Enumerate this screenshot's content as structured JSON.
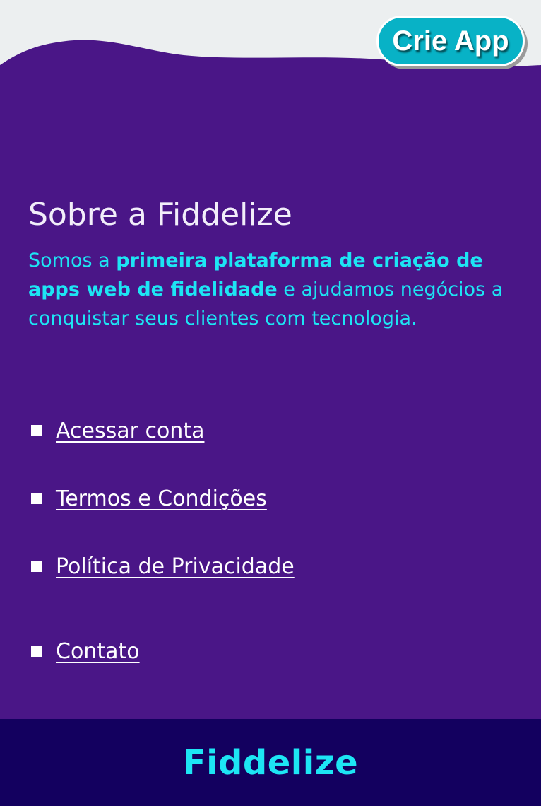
{
  "header": {
    "cta_label": "Crie App"
  },
  "about": {
    "title": "Sobre a Fiddelize",
    "text_start": "Somos a ",
    "text_bold": "primeira plataforma de criação de apps web de fidelidade",
    "text_end": " e ajudamos negócios a conquistar seus clientes com tecnologia."
  },
  "links": [
    {
      "label": "Acessar conta"
    },
    {
      "label": "Termos e Condições"
    },
    {
      "label": "Política de Privacidade"
    },
    {
      "label": "Contato"
    }
  ],
  "footer": {
    "brand": "Fiddelize"
  },
  "colors": {
    "background": "#4a1687",
    "accent_cyan": "#1de5f4",
    "button": "#08b2c6",
    "footer": "#13005f",
    "top_band": "#eceff0"
  }
}
